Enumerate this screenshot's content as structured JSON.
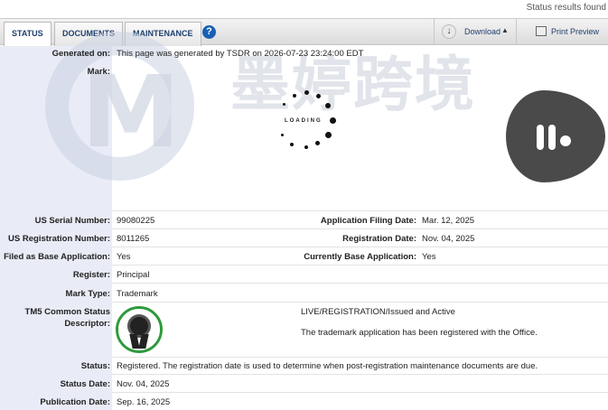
{
  "topbar": {
    "status_text": "Status results found"
  },
  "tabs": [
    {
      "label": "STATUS",
      "active": true
    },
    {
      "label": "DOCUMENTS",
      "active": false
    },
    {
      "label": "MAINTENANCE",
      "active": false
    }
  ],
  "toolbar": {
    "help_glyph": "?",
    "download_label": "Download",
    "download_icon": "download-arrow-icon",
    "print_label": "Print Preview",
    "print_icon": "printer-icon"
  },
  "header": {
    "generated_label": "Generated on:",
    "generated_value": "This page was generated by TSDR on 2026-07-23 23:24:00 EDT",
    "mark_label": "Mark:",
    "loading_text": "LOADING"
  },
  "watermark": {
    "text": "墨婷跨境",
    "letter": "M"
  },
  "fields": {
    "serial_label": "US Serial Number:",
    "serial_value": "99080225",
    "filing_label": "Application Filing Date:",
    "filing_value": "Mar. 12, 2025",
    "reg_num_label": "US Registration Number:",
    "reg_num_value": "8011265",
    "reg_date_label": "Registration Date:",
    "reg_date_value": "Nov. 04, 2025",
    "base_app_label": "Filed as Base Application:",
    "base_app_value": "Yes",
    "curr_base_label": "Currently Base Application:",
    "curr_base_value": "Yes",
    "register_label": "Register:",
    "register_value": "Principal",
    "mark_type_label": "Mark Type:",
    "mark_type_value": "Trademark",
    "tm5_label_line1": "TM5 Common Status",
    "tm5_label_line2": "Descriptor:",
    "tm5_status": "LIVE/REGISTRATION/Issued and Active",
    "tm5_desc": "The trademark application has been registered with the Office.",
    "status_label": "Status:",
    "status_value": "Registered. The registration date is used to determine when post-registration maintenance documents are due.",
    "status_date_label": "Status Date:",
    "status_date_value": "Nov. 04, 2025",
    "pub_date_label": "Publication Date:",
    "pub_date_value": "Sep. 16, 2025"
  },
  "colors": {
    "accent": "#1f3f6e",
    "badge_border": "#2e9a3b",
    "help": "#1a5fb4"
  }
}
